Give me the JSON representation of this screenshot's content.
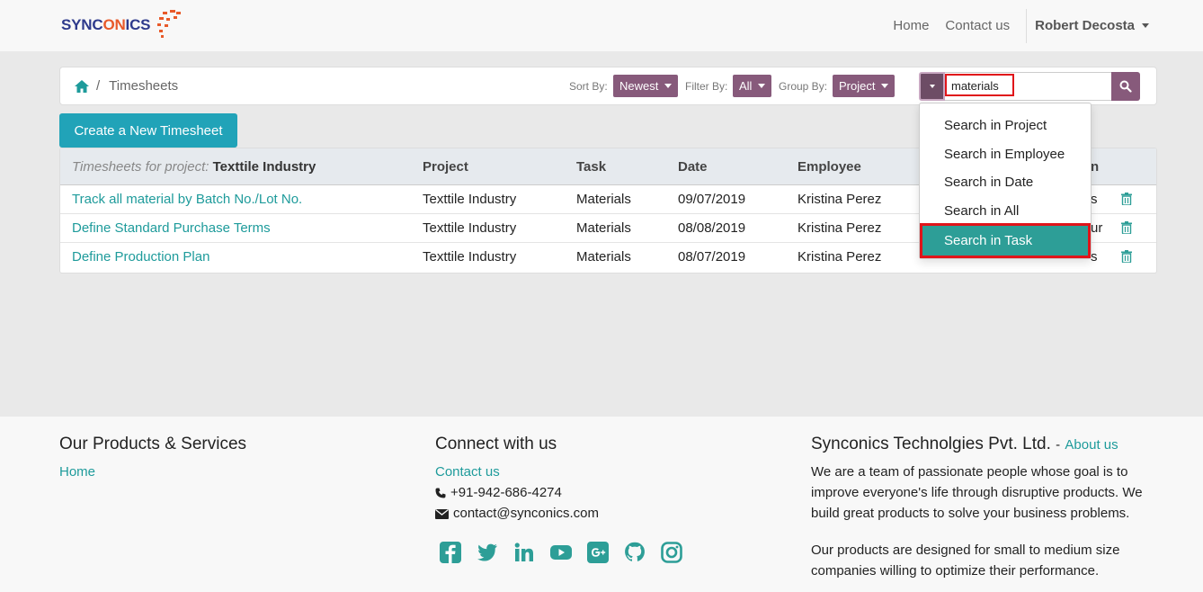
{
  "brand": {
    "name_part1": "SYNC",
    "name_part2": "ON",
    "name_part3": "ICS"
  },
  "nav": {
    "home": "Home",
    "contact": "Contact us",
    "user": "Robert Decosta"
  },
  "breadcrumb": {
    "separator": "/",
    "current": "Timesheets"
  },
  "toolbar": {
    "sort_label": "Sort By:",
    "sort_value": "Newest",
    "filter_label": "Filter By:",
    "filter_value": "All",
    "group_label": "Group By:",
    "group_value": "Project",
    "search_value": "materials"
  },
  "create_button": "Create a New Timesheet",
  "table": {
    "group_label": "Timesheets for project:",
    "group_value": "Texttile Industry",
    "headers": {
      "project": "Project",
      "task": "Task",
      "date": "Date",
      "employee": "Employee",
      "duration_tail": "n"
    },
    "rows": [
      {
        "name": "Track all material by Batch No./Lot No.",
        "project": "Texttile Industry",
        "task": "Materials",
        "date": "09/07/2019",
        "employee": "Kristina Perez",
        "duration_tail": "s"
      },
      {
        "name": "Define Standard Purchase Terms",
        "project": "Texttile Industry",
        "task": "Materials",
        "date": "08/08/2019",
        "employee": "Kristina Perez",
        "duration_tail": "ur"
      },
      {
        "name": "Define Production Plan",
        "project": "Texttile Industry",
        "task": "Materials",
        "date": "08/07/2019",
        "employee": "Kristina Perez",
        "duration_tail": "s"
      }
    ]
  },
  "search_menu": {
    "items": [
      "Search in Project",
      "Search in Employee",
      "Search in Date",
      "Search in All",
      "Search in Task"
    ],
    "active_index": 4
  },
  "footer": {
    "products_heading": "Our Products & Services",
    "products_home": "Home",
    "connect_heading": "Connect with us",
    "contact_link": "Contact us",
    "phone": "+91-942-686-4274",
    "email": "contact@synconics.com",
    "company_heading": "Synconics Technolgies Pvt. Ltd.",
    "company_dash": "-",
    "about_link": "About us",
    "para1": "We are a team of passionate people whose goal is to improve everyone's life through disruptive products. We build great products to solve your business problems.",
    "para2": "Our products are designed for small to medium size companies willing to optimize their performance."
  },
  "colors": {
    "accent": "#875a7b",
    "teal": "#21a3b8",
    "link": "#1e9b9b",
    "active_item": "#2d9e97",
    "highlight": "#e0141a"
  },
  "icons": [
    "home-icon",
    "search-icon",
    "trash-icon",
    "phone-icon",
    "envelope-icon",
    "facebook-icon",
    "twitter-icon",
    "linkedin-icon",
    "youtube-icon",
    "google-plus-icon",
    "github-icon",
    "instagram-icon"
  ]
}
